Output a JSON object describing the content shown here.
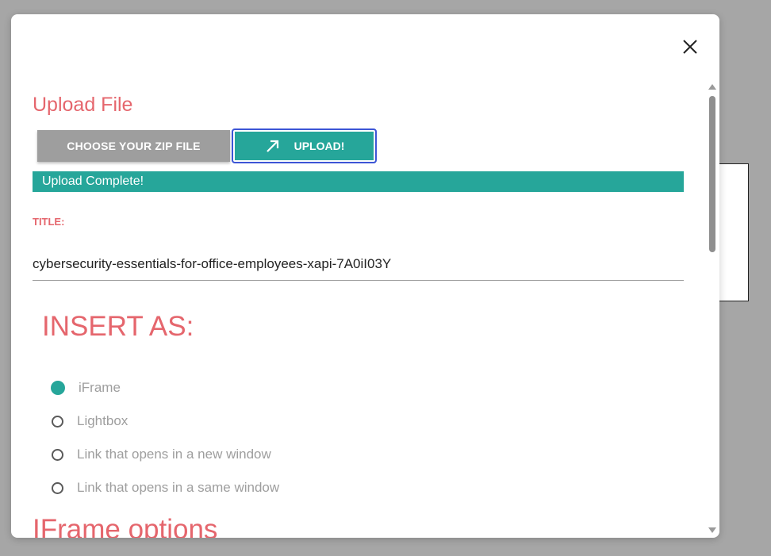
{
  "modal": {
    "close_label": "×"
  },
  "upload": {
    "heading": "Upload File",
    "choose_label": "CHOOSE YOUR ZIP FILE",
    "upload_label": "UPLOAD!",
    "status": "Upload Complete!",
    "progress_percent": 100
  },
  "title_field": {
    "label": "TITLE:",
    "value": "cybersecurity-essentials-for-office-employees-xapi-7A0iI03Y"
  },
  "insert_as": {
    "heading": "INSERT AS:",
    "options": [
      {
        "label": "iFrame",
        "checked": true
      },
      {
        "label": "Lightbox",
        "checked": false
      },
      {
        "label": "Link that opens in a new window",
        "checked": false
      },
      {
        "label": "Link that opens in a same window",
        "checked": false
      }
    ]
  },
  "iframe_options": {
    "heading": "IFrame options"
  },
  "colors": {
    "accent": "#26a69a",
    "heading": "#e5666d",
    "button_gray": "#9e9e9e",
    "focus_ring": "#3d55d6"
  },
  "icons": {
    "close": "close-icon",
    "upload": "arrow-up-right-icon"
  }
}
